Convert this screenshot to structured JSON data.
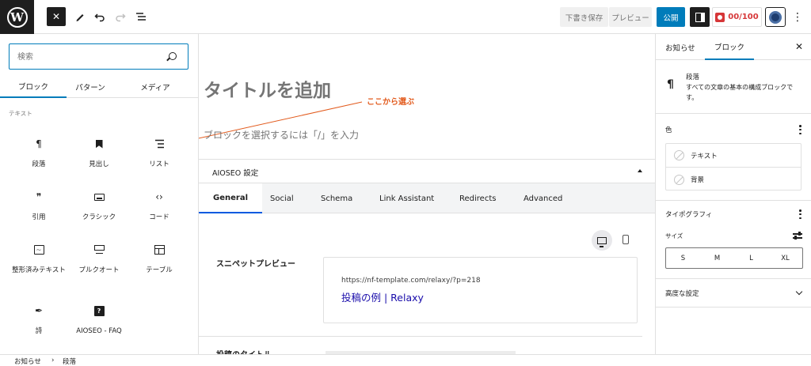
{
  "topbar": {
    "logo_letter": "W",
    "close_glyph": "✕",
    "draft_label": "下書き保存",
    "preview_label": "プレビュー",
    "publish_label": "公開",
    "score_label": "00/100",
    "more_glyph": "⋮",
    "icons": [
      "wordpress-logo",
      "close-icon",
      "pen-icon",
      "undo-icon",
      "redo-icon",
      "list-view-icon",
      "settings-panel-icon",
      "aioseo-score-icon",
      "aioseo-gear-icon",
      "more-vertical-icon"
    ]
  },
  "inserter": {
    "search_placeholder": "検索",
    "tabs": [
      "ブロック",
      "パターン",
      "メディア"
    ],
    "category": "テキスト",
    "blocks": [
      {
        "label": "段落",
        "icon": "paragraph-icon",
        "glyph": "¶"
      },
      {
        "label": "見出し",
        "icon": "bookmark-icon",
        "glyph": ""
      },
      {
        "label": "リスト",
        "icon": "list-icon",
        "glyph": "☰"
      },
      {
        "label": "引用",
        "icon": "quote-icon",
        "glyph": "❞"
      },
      {
        "label": "クラシック",
        "icon": "keyboard-icon",
        "glyph": ""
      },
      {
        "label": "コード",
        "icon": "code-icon",
        "glyph": "‹›"
      },
      {
        "label": "整形済みテキスト",
        "icon": "preformatted-icon",
        "glyph": ""
      },
      {
        "label": "プルクオート",
        "icon": "pullquote-icon",
        "glyph": ""
      },
      {
        "label": "テーブル",
        "icon": "table-icon",
        "glyph": ""
      },
      {
        "label": "詩",
        "icon": "feather-icon",
        "glyph": "✒"
      },
      {
        "label": "AIOSEO - FAQ",
        "icon": "faq-icon",
        "glyph": "?"
      }
    ]
  },
  "editor": {
    "title_placeholder": "タイトルを追加",
    "annotation": "ここから選ぶ",
    "block_placeholder": "ブロックを選択するには「/」を入力",
    "accent_color": "#e25a1c",
    "aioseo": {
      "header": "AIOSEO 設定",
      "tabs": [
        "General",
        "Social",
        "Schema",
        "Link Assistant",
        "Redirects",
        "Advanced"
      ],
      "active_tab": "General",
      "snippet_label": "スニペットプレビュー",
      "snippet_url": "https://nf-template.com/relaxy/?p=218",
      "snippet_title": "投稿の例 | Relaxy",
      "next_label": "投稿のタイトル"
    }
  },
  "sidebar": {
    "tabs": [
      "お知らせ",
      "ブロック"
    ],
    "active_tab": "ブロック",
    "close_glyph": "✕",
    "block_name": "段落",
    "block_desc": "すべての文章の基本の構成ブロックです。",
    "color_heading": "色",
    "color_items": [
      "テキスト",
      "背景"
    ],
    "typography_heading": "タイポグラフィ",
    "size_label": "サイズ",
    "size_options": [
      "S",
      "M",
      "L",
      "XL"
    ],
    "advanced_label": "高度な設定"
  },
  "footer": {
    "crumbs": [
      "お知らせ",
      "›",
      "段落"
    ]
  },
  "colors": {
    "publish": "#007cba",
    "score": "#d63638",
    "snippet_link": "#1a0dab",
    "dark": "#1e1e1e"
  }
}
